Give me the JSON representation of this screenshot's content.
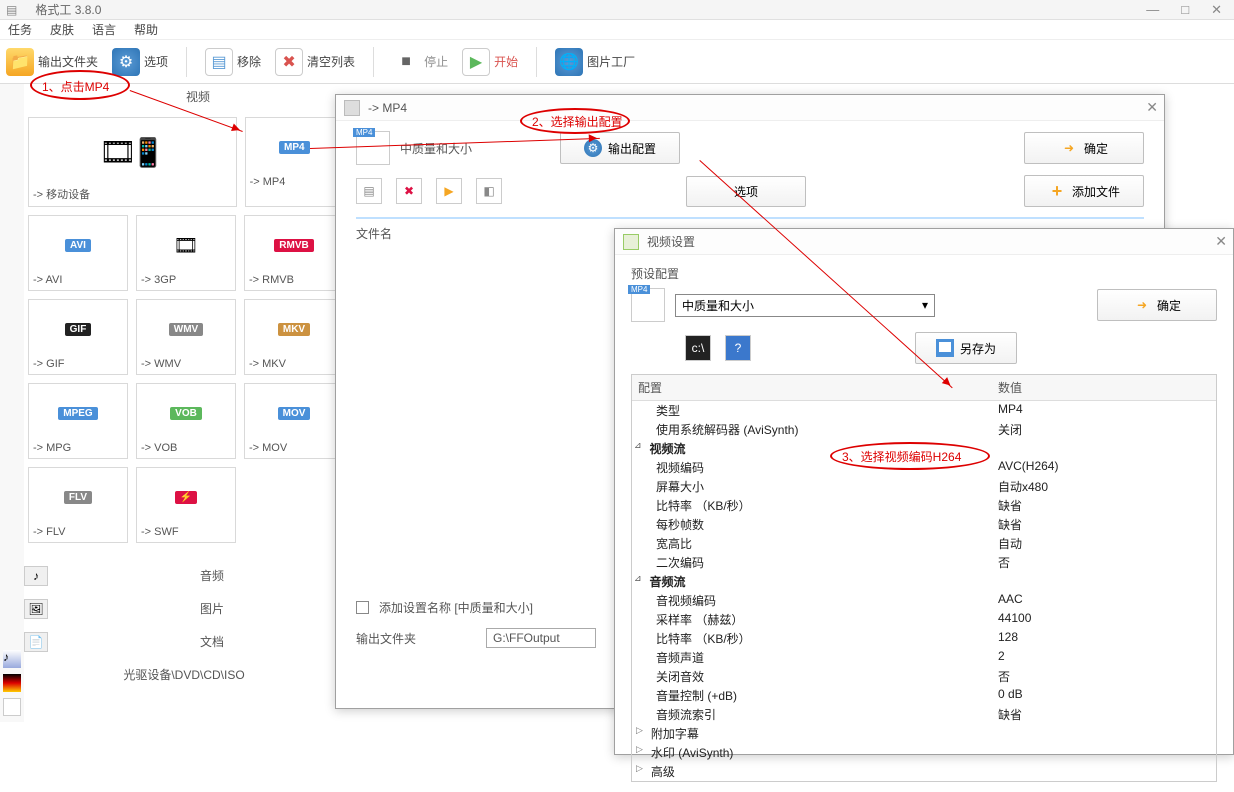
{
  "app": {
    "title": "格式⼯",
    "version": "3.8.0"
  },
  "menu": {
    "tasks": "任务",
    "skin": "皮肤",
    "language": "语言",
    "help": "帮助"
  },
  "toolbar": {
    "output_folder": "输出文件夹",
    "options": "选项",
    "remove": "移除",
    "clear_list": "清空列表",
    "stop": "停止",
    "start": "开始",
    "picture_factory": "图片工厂"
  },
  "tabs": {
    "video": "视频",
    "audio": "音频",
    "image": "图片",
    "doc": "文档",
    "optical": "光驱设备\\DVD\\CD\\ISO"
  },
  "formats": {
    "mobile": "-> 移动设备",
    "mp4": "-> MP4",
    "avi": "-> AVI",
    "3gp": "-> 3GP",
    "rmvb": "-> RMVB",
    "gif": "-> GIF",
    "wmv": "-> WMV",
    "mkv": "-> MKV",
    "mpg": "-> MPG",
    "vob": "-> VOB",
    "mov": "-> MOV",
    "flv": "-> FLV",
    "swf": "-> SWF"
  },
  "dlg1": {
    "title": "-> MP4",
    "quality": "中质量和大小",
    "output_config": "输出配置",
    "ok": "确定",
    "options": "选项",
    "add_file": "添加文件",
    "file_name": "文件名",
    "add_setting_name": "添加设置名称 [中质量和大小]",
    "output_folder": "输出文件夹",
    "output_path": "G:\\FFOutput"
  },
  "dlg2": {
    "title": "视频设置",
    "preset_config": "预设配置",
    "quality_select": "中质量和大小",
    "ok": "确定",
    "save_as": "另存为",
    "col_config": "配置",
    "col_value": "数值",
    "rows": [
      {
        "k": "类型",
        "v": "MP4",
        "t": "leaf"
      },
      {
        "k": "使用系统解码器 (AviSynth)",
        "v": "关闭",
        "t": "leaf"
      },
      {
        "k": "视频流",
        "v": "",
        "t": "group"
      },
      {
        "k": "视频编码",
        "v": "AVC(H264)",
        "t": "leaf"
      },
      {
        "k": "屏幕大小",
        "v": "自动x480",
        "t": "leaf"
      },
      {
        "k": "比特率 （KB/秒）",
        "v": "缺省",
        "t": "leaf"
      },
      {
        "k": "每秒帧数",
        "v": "缺省",
        "t": "leaf"
      },
      {
        "k": "宽高比",
        "v": "自动",
        "t": "leaf"
      },
      {
        "k": "二次编码",
        "v": "否",
        "t": "leaf"
      },
      {
        "k": "音频流",
        "v": "",
        "t": "group"
      },
      {
        "k": "音视频编码",
        "v": "AAC",
        "t": "leaf"
      },
      {
        "k": "采样率 （赫兹）",
        "v": "44100",
        "t": "leaf"
      },
      {
        "k": "比特率 （KB/秒）",
        "v": "128",
        "t": "leaf"
      },
      {
        "k": "音频声道",
        "v": "2",
        "t": "leaf"
      },
      {
        "k": "关闭音效",
        "v": "否",
        "t": "leaf"
      },
      {
        "k": "音量控制 (+dB)",
        "v": "0 dB",
        "t": "leaf"
      },
      {
        "k": "音频流索引",
        "v": "缺省",
        "t": "leaf"
      },
      {
        "k": "附加字幕",
        "v": "",
        "t": "sub"
      },
      {
        "k": "水印 (AviSynth)",
        "v": "",
        "t": "sub"
      },
      {
        "k": "高级",
        "v": "",
        "t": "sub"
      }
    ]
  },
  "annotations": {
    "a1": "1、点击MP4",
    "a2": "2、选择输出配置",
    "a3": "3、选择视频编码H264"
  }
}
